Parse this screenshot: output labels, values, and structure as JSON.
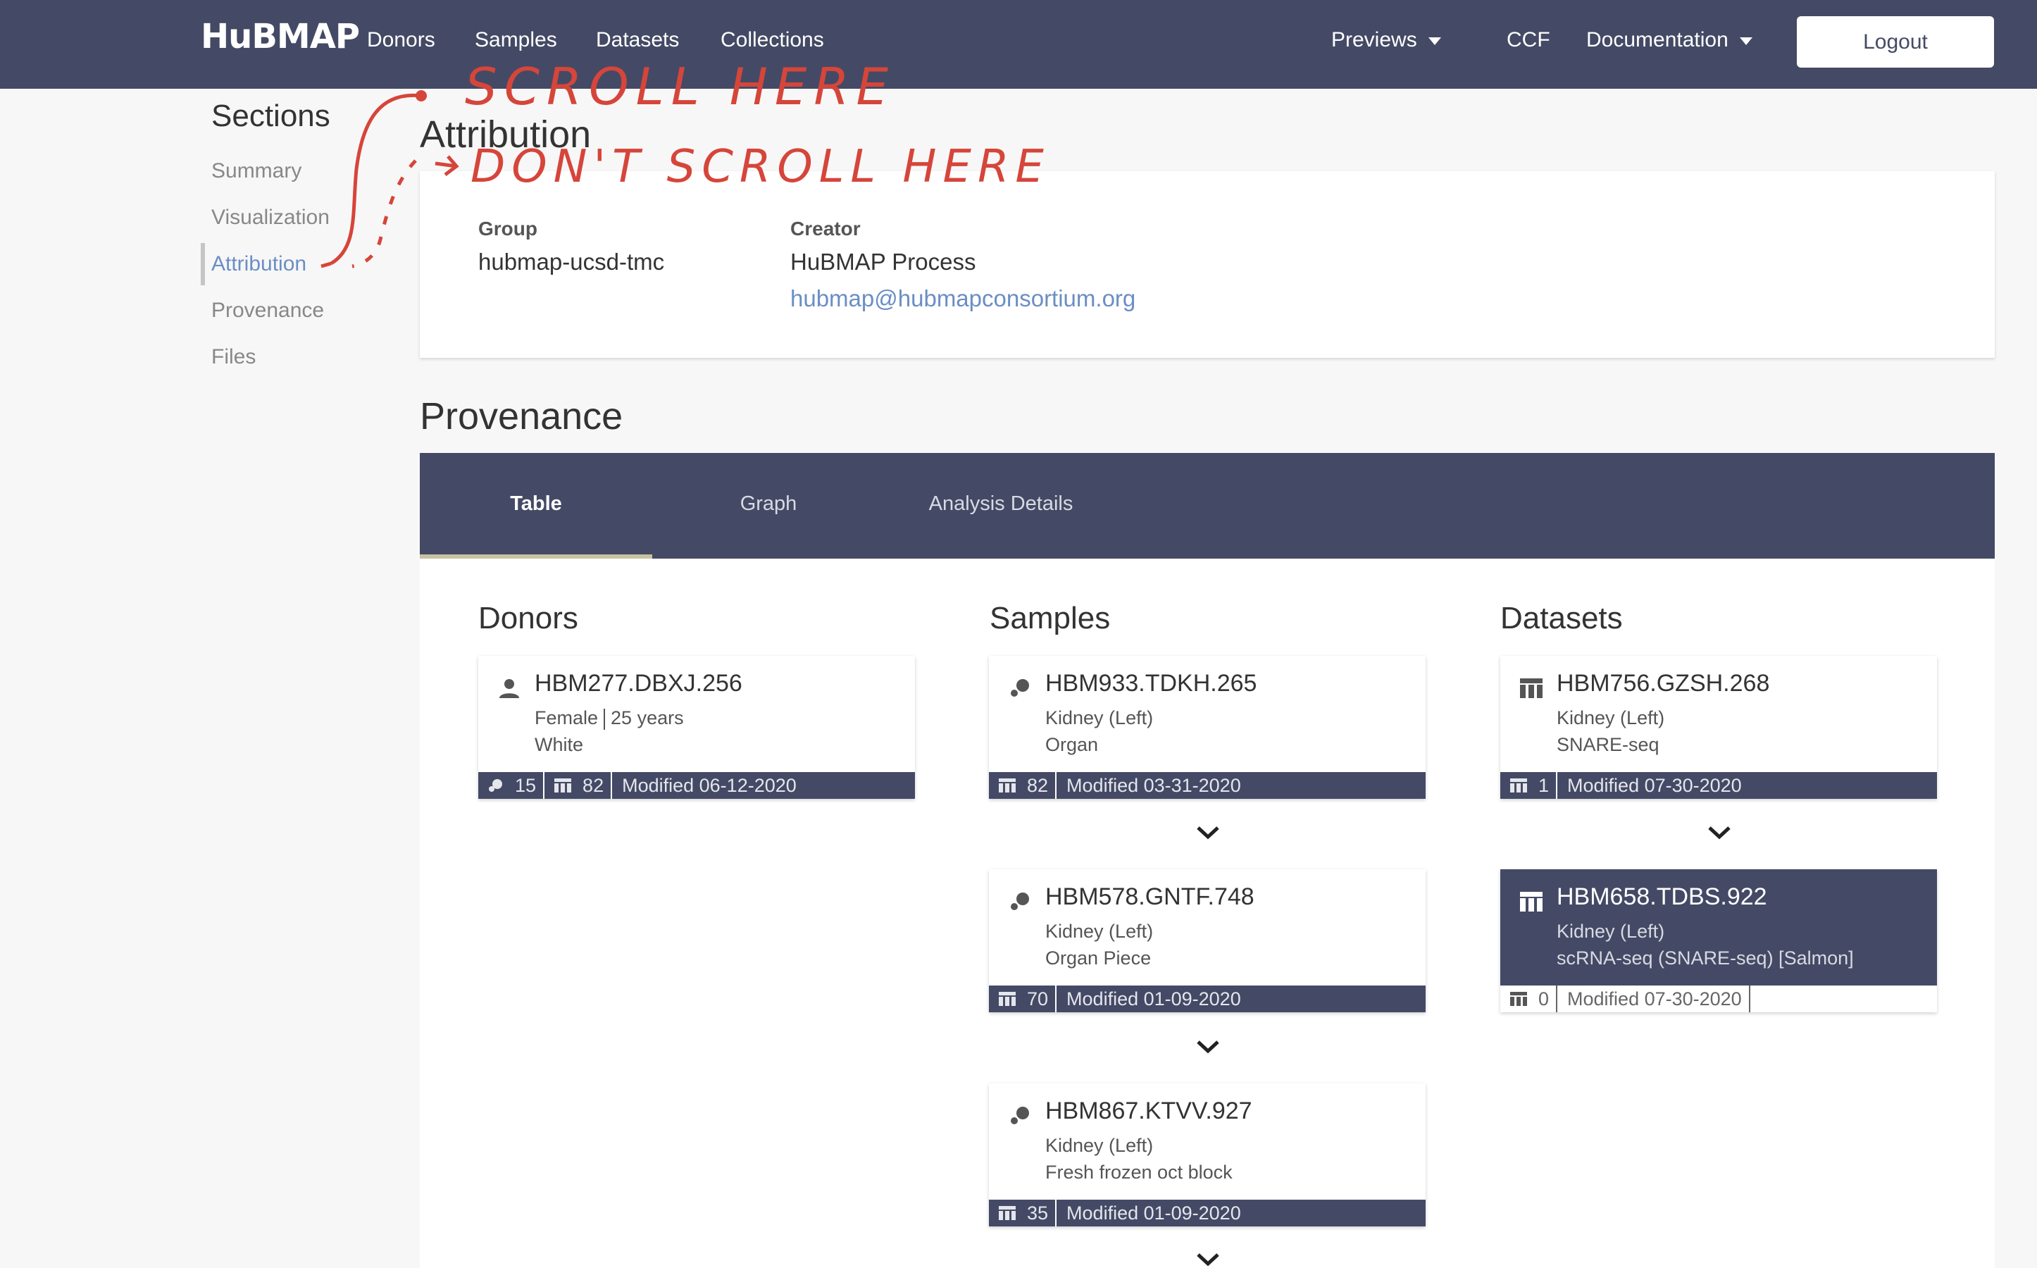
{
  "navbar": {
    "logo": "HuBMAP",
    "links": [
      "Donors",
      "Samples",
      "Datasets",
      "Collections"
    ],
    "previews_label": "Previews",
    "ccf_label": "CCF",
    "documentation_label": "Documentation",
    "logout_label": "Logout"
  },
  "sidebar": {
    "title": "Sections",
    "items": [
      {
        "label": "Summary"
      },
      {
        "label": "Visualization"
      },
      {
        "label": "Attribution"
      },
      {
        "label": "Provenance"
      },
      {
        "label": "Files"
      }
    ]
  },
  "attribution": {
    "title": "Attribution",
    "group_label": "Group",
    "group_value": "hubmap-ucsd-tmc",
    "creator_label": "Creator",
    "creator_name": "HuBMAP Process",
    "creator_email": "hubmap@hubmapconsortium.org"
  },
  "provenance": {
    "title": "Provenance",
    "tabs": [
      "Table",
      "Graph",
      "Analysis Details"
    ],
    "donors_title": "Donors",
    "samples_title": "Samples",
    "datasets_title": "Datasets",
    "donor": {
      "id": "HBM277.DBXJ.256",
      "sex": "Female",
      "age": "25 years",
      "race": "White",
      "samples_count": "15",
      "datasets_count": "82",
      "modified": "Modified 06-12-2020"
    },
    "samples": [
      {
        "id": "HBM933.TDKH.265",
        "organ": "Kidney (Left)",
        "type": "Organ",
        "datasets_count": "82",
        "modified": "Modified 03-31-2020"
      },
      {
        "id": "HBM578.GNTF.748",
        "organ": "Kidney (Left)",
        "type": "Organ Piece",
        "datasets_count": "70",
        "modified": "Modified 01-09-2020"
      },
      {
        "id": "HBM867.KTVV.927",
        "organ": "Kidney (Left)",
        "type": "Fresh frozen oct block",
        "datasets_count": "35",
        "modified": "Modified 01-09-2020"
      }
    ],
    "datasets": [
      {
        "id": "HBM756.GZSH.268",
        "organ": "Kidney (Left)",
        "assay": "SNARE-seq",
        "datasets_count": "1",
        "modified": "Modified 07-30-2020"
      },
      {
        "id": "HBM658.TDBS.922",
        "organ": "Kidney (Left)",
        "assay": "scRNA-seq (SNARE-seq) [Salmon]",
        "datasets_count": "0",
        "modified": "Modified 07-30-2020"
      }
    ]
  },
  "annotations": {
    "scroll_here": "SCROLL HERE",
    "dont_scroll_here": "DON'T SCROLL HERE"
  },
  "colors": {
    "navbar": "#444a65",
    "link": "#6b8ec4",
    "annotation": "#d6453a"
  }
}
